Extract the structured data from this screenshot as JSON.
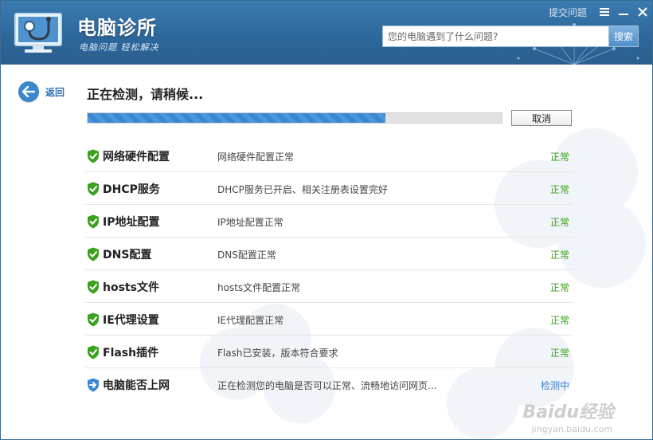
{
  "app": {
    "title": "电脑诊所",
    "slogan": "电脑问题 轻松解决",
    "feedback_link": "提交问题"
  },
  "search": {
    "placeholder": "您的电脑遇到了什么问题?",
    "button_label": "搜索"
  },
  "nav": {
    "back_label": "返回"
  },
  "scan": {
    "status_title": "正在检测，请稍候...",
    "progress": 0.72,
    "cancel_label": "取消"
  },
  "checks": [
    {
      "name": "网络硬件配置",
      "desc": "网络硬件配置正常",
      "result": "正常",
      "state": "ok"
    },
    {
      "name": "DHCP服务",
      "desc": "DHCP服务已开启、相关注册表设置完好",
      "result": "正常",
      "state": "ok"
    },
    {
      "name": "IP地址配置",
      "desc": "IP地址配置正常",
      "result": "正常",
      "state": "ok"
    },
    {
      "name": "DNS配置",
      "desc": "DNS配置正常",
      "result": "正常",
      "state": "ok"
    },
    {
      "name": "hosts文件",
      "desc": "hosts文件配置正常",
      "result": "正常",
      "state": "ok"
    },
    {
      "name": "IE代理设置",
      "desc": "IE代理配置正常",
      "result": "正常",
      "state": "ok"
    },
    {
      "name": "Flash插件",
      "desc": "Flash已安装，版本符合要求",
      "result": "正常",
      "state": "ok"
    },
    {
      "name": "电脑能否上网",
      "desc": "正在检测您的电脑是否可以正常、流畅地访问网页...",
      "result": "检测中",
      "state": "busy"
    }
  ],
  "watermark": {
    "brand": "Baidu经验",
    "url": "jingyan.baidu.com"
  },
  "colors": {
    "header": "#2d6699",
    "accent": "#3b86cc",
    "ok": "#3aa01e",
    "shield_ok": "#3aa01e",
    "shield_busy": "#3a86d4"
  }
}
